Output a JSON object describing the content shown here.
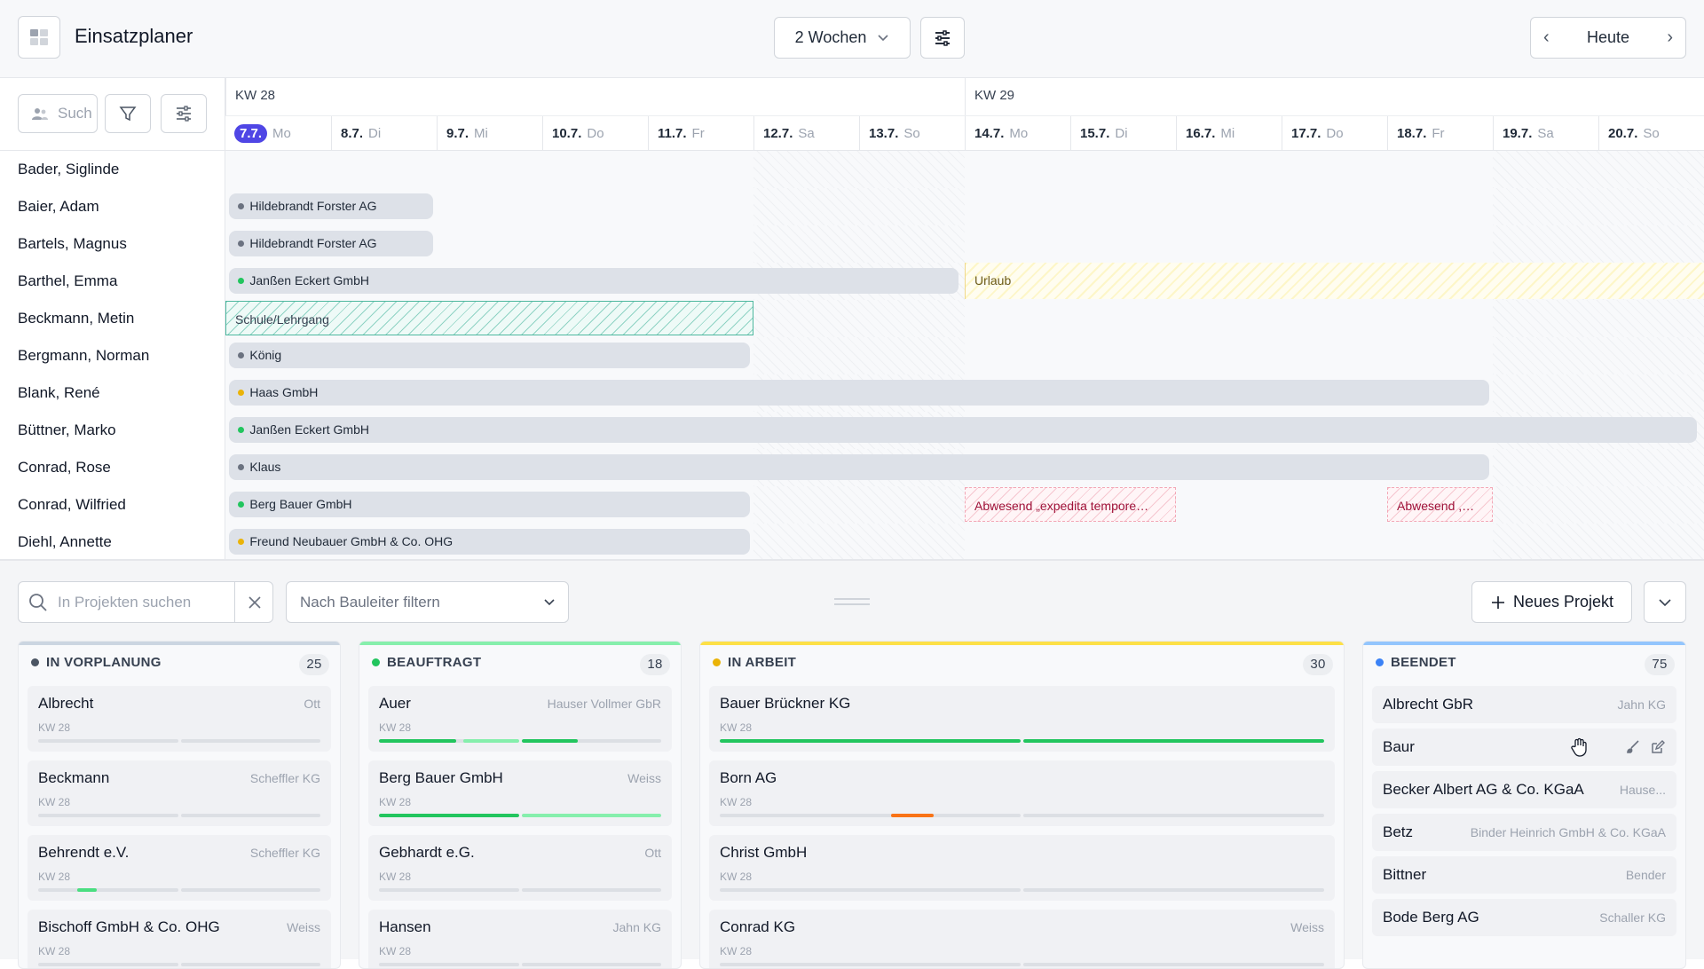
{
  "app": {
    "title": "Einsatzplaner"
  },
  "toolbar": {
    "range_label": "2 Wochen",
    "today_label": "Heute"
  },
  "planner": {
    "search_placeholder": "Such",
    "weeks": [
      "KW 28",
      "KW 29"
    ],
    "days": [
      {
        "num": "7.7.",
        "wd": "Mo",
        "today": true
      },
      {
        "num": "8.7.",
        "wd": "Di"
      },
      {
        "num": "9.7.",
        "wd": "Mi"
      },
      {
        "num": "10.7.",
        "wd": "Do"
      },
      {
        "num": "11.7.",
        "wd": "Fr"
      },
      {
        "num": "12.7.",
        "wd": "Sa"
      },
      {
        "num": "13.7.",
        "wd": "So"
      },
      {
        "num": "14.7.",
        "wd": "Mo"
      },
      {
        "num": "15.7.",
        "wd": "Di"
      },
      {
        "num": "16.7.",
        "wd": "Mi"
      },
      {
        "num": "17.7.",
        "wd": "Do"
      },
      {
        "num": "18.7.",
        "wd": "Fr"
      },
      {
        "num": "19.7.",
        "wd": "Sa"
      },
      {
        "num": "20.7.",
        "wd": "So"
      }
    ],
    "rows": [
      {
        "name": "Bader, Siglinde"
      },
      {
        "name": "Baier, Adam",
        "bar": "Hildebrandt Forster AG",
        "dot": "gray"
      },
      {
        "name": "Bartels, Magnus",
        "bar": "Hildebrandt Forster AG",
        "dot": "gray"
      },
      {
        "name": "Barthel, Emma",
        "bar": "Janßen Eckert GmbH",
        "dot": "green",
        "urlaub": "Urlaub"
      },
      {
        "name": "Beckmann, Metin",
        "schule": "Schule/Lehrgang"
      },
      {
        "name": "Bergmann, Norman",
        "bar": "König",
        "dot": "gray"
      },
      {
        "name": "Blank, René",
        "bar": "Haas GmbH",
        "dot": "yellow"
      },
      {
        "name": "Büttner, Marko",
        "bar": "Janßen Eckert GmbH",
        "dot": "green"
      },
      {
        "name": "Conrad, Rose",
        "bar": "Klaus",
        "dot": "gray"
      },
      {
        "name": "Conrad, Wilfried",
        "bar": "Berg Bauer GmbH",
        "dot": "green",
        "abw1": "Abwesend „expedita tempore…",
        "abw2": "Abwesend ,…"
      },
      {
        "name": "Diehl, Annette",
        "bar": "Freund Neubauer GmbH & Co. OHG",
        "dot": "yellow"
      }
    ]
  },
  "board": {
    "search_placeholder": "In Projekten suchen",
    "filter_label": "Nach Bauleiter filtern",
    "new_project_label": "Neues Projekt",
    "columns": [
      {
        "title": "IN VORPLANUNG",
        "count": "25",
        "color": "#4b5563",
        "cards": [
          {
            "title": "Albrecht",
            "right": "Ott",
            "sub": "KW 28"
          },
          {
            "title": "Beckmann",
            "right": "Scheffler KG",
            "sub": "KW 28"
          },
          {
            "title": "Behrendt e.V.",
            "right": "Scheffler KG",
            "sub": "KW 28"
          },
          {
            "title": "Bischoff GmbH & Co. OHG",
            "right": "Weiss",
            "sub": "KW 28"
          }
        ]
      },
      {
        "title": "BEAUFTRAGT",
        "count": "18",
        "color": "#22c55e",
        "cards": [
          {
            "title": "Auer",
            "right": "Hauser Vollmer GbR",
            "sub": "KW 28"
          },
          {
            "title": "Berg Bauer GmbH",
            "right": "Weiss",
            "sub": "KW 28"
          },
          {
            "title": "Gebhardt e.G.",
            "right": "Ott",
            "sub": "KW 28"
          },
          {
            "title": "Hansen",
            "right": "Jahn KG",
            "sub": "KW 28"
          }
        ]
      },
      {
        "title": "IN ARBEIT",
        "count": "30",
        "color": "#eab308",
        "cards": [
          {
            "title": "Bauer Brückner KG",
            "right": "",
            "sub": "KW 28"
          },
          {
            "title": "Born AG",
            "right": "",
            "sub": "KW 28"
          },
          {
            "title": "Christ GmbH",
            "right": "",
            "sub": "KW 28"
          },
          {
            "title": "Conrad KG",
            "right": "Weiss",
            "sub": "KW 28"
          }
        ]
      },
      {
        "title": "BEENDET",
        "count": "75",
        "color": "#3b82f6",
        "cards": [
          {
            "title": "Albrecht GbR",
            "right": "Jahn KG"
          },
          {
            "title": "Baur",
            "right": ""
          },
          {
            "title": "Becker Albert AG & Co. KGaA",
            "right": "Hause..."
          },
          {
            "title": "Betz",
            "right": "Binder Heinrich GmbH & Co. KGaA"
          },
          {
            "title": "Bittner",
            "right": "Bender"
          },
          {
            "title": "Bode Berg AG",
            "right": "Schaller KG"
          }
        ]
      }
    ]
  }
}
